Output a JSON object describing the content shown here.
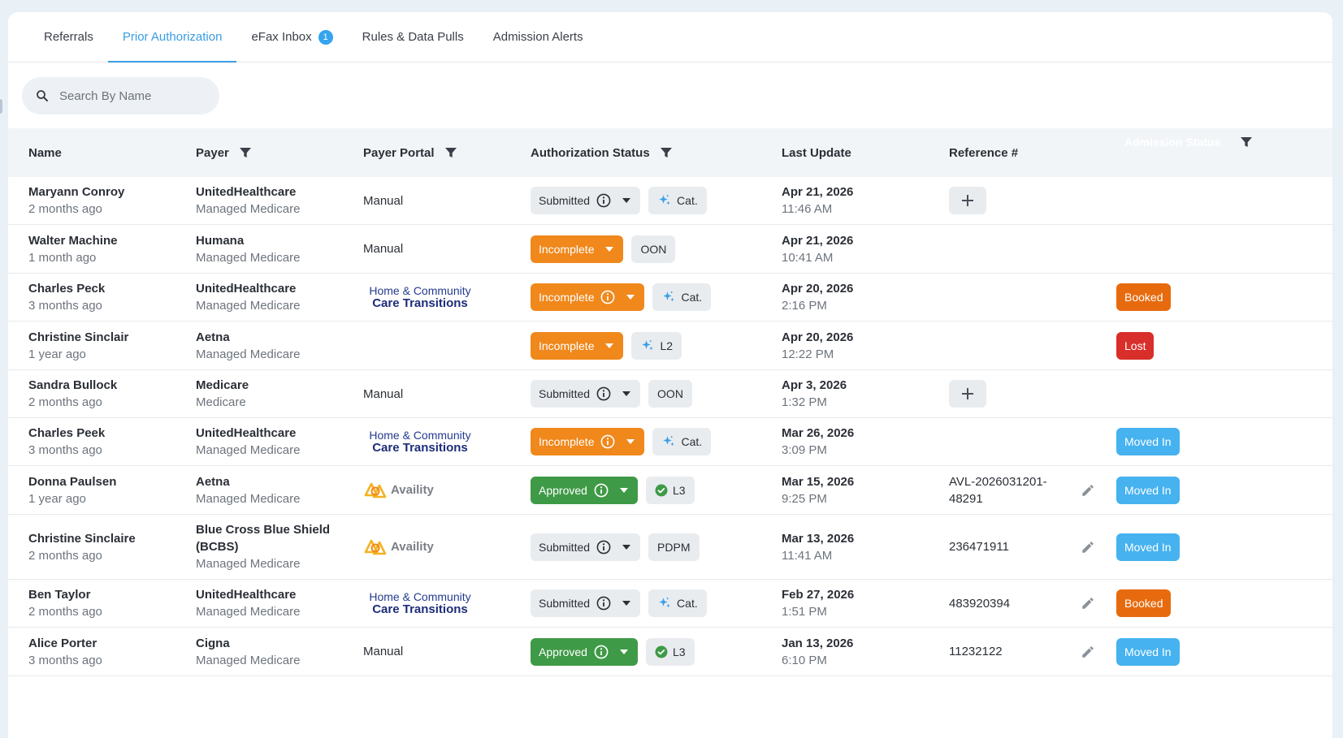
{
  "tabs": [
    {
      "label": "Referrals",
      "active": false
    },
    {
      "label": "Prior Authorization",
      "active": true
    },
    {
      "label": "eFax Inbox",
      "badge": "1",
      "active": false
    },
    {
      "label": "Rules & Data Pulls",
      "active": false
    },
    {
      "label": "Admission Alerts",
      "active": false
    }
  ],
  "search": {
    "placeholder": "Search By Name",
    "value": ""
  },
  "columns": {
    "name": "Name",
    "payer": "Payer",
    "portal": "Payer Portal",
    "auth": "Authorization Status",
    "update": "Last Update",
    "ref": "Reference #",
    "admission": "Admission Status"
  },
  "portal_labels": {
    "manual": "Manual",
    "hcct_line1": "Home & Community",
    "hcct_line2": "Care Transitions",
    "availity": "Availity"
  },
  "rows": [
    {
      "name": "Maryann Conroy",
      "age": "2 months ago",
      "payer": "UnitedHealthcare",
      "plan": "Managed Medicare",
      "portal": "Manual",
      "status": "Submitted",
      "tag": "Cat.",
      "date": "Apr 21, 2026",
      "time": "11:46 AM",
      "ref": "",
      "admission": ""
    },
    {
      "name": "Walter Machine",
      "age": "1 month ago",
      "payer": "Humana",
      "plan": "Managed Medicare",
      "portal": "Manual",
      "status": "Incomplete",
      "tag": "OON",
      "date": "Apr 21, 2026",
      "time": "10:41 AM",
      "ref": "",
      "admission": ""
    },
    {
      "name": "Charles Peck",
      "age": "3 months ago",
      "payer": "UnitedHealthcare",
      "plan": "Managed Medicare",
      "portal": "hcct",
      "status": "Incomplete",
      "tag": "Cat.",
      "date": "Apr 20, 2026",
      "time": "2:16 PM",
      "ref": "",
      "admission": "Booked"
    },
    {
      "name": "Christine Sinclair",
      "age": "1 year ago",
      "payer": "Aetna",
      "plan": "Managed Medicare",
      "portal": "",
      "status": "Incomplete",
      "tag": "L2",
      "date": "Apr 20, 2026",
      "time": "12:22 PM",
      "ref": "",
      "admission": "Lost"
    },
    {
      "name": "Sandra Bullock",
      "age": "2 months ago",
      "payer": "Medicare",
      "plan": "Medicare",
      "portal": "Manual",
      "status": "Submitted",
      "tag": "OON",
      "date": "Apr 3, 2026",
      "time": "1:32 PM",
      "ref": "",
      "admission": ""
    },
    {
      "name": "Charles Peek",
      "age": "3 months ago",
      "payer": "UnitedHealthcare",
      "plan": "Managed Medicare",
      "portal": "hcct",
      "status": "Incomplete",
      "tag": "Cat.",
      "date": "Mar 26, 2026",
      "time": "3:09 PM",
      "ref": "",
      "admission": "Moved In"
    },
    {
      "name": "Donna Paulsen",
      "age": "1 year ago",
      "payer": "Aetna",
      "plan": "Managed Medicare",
      "portal": "availity",
      "status": "Approved",
      "tag": "L3",
      "date": "Mar 15, 2026",
      "time": "9:25 PM",
      "ref": "AVL-2026031201-48291",
      "admission": "Moved In"
    },
    {
      "name": "Christine Sinclaire",
      "age": "2 months ago",
      "payer": "Blue Cross Blue Shield (BCBS)",
      "plan": "Managed Medicare",
      "portal": "availity",
      "status": "Submitted",
      "tag": "PDPM",
      "date": "Mar 13, 2026",
      "time": "11:41 AM",
      "ref": "236471911",
      "admission": "Moved In"
    },
    {
      "name": "Ben Taylor",
      "age": "2 months ago",
      "payer": "UnitedHealthcare",
      "plan": "Managed Medicare",
      "portal": "hcct",
      "status": "Submitted",
      "tag": "Cat.",
      "date": "Feb 27, 2026",
      "time": "1:51 PM",
      "ref": "483920394",
      "admission": "Booked"
    },
    {
      "name": "Alice Porter",
      "age": "3 months ago",
      "payer": "Cigna",
      "plan": "Managed Medicare",
      "portal": "Manual",
      "status": "Approved",
      "tag": "L3",
      "date": "Jan 13, 2026",
      "time": "6:10 PM",
      "ref": "11232122",
      "admission": "Moved In"
    }
  ],
  "colors": {
    "accent": "#3a9ce2",
    "incomplete": "#f0881c",
    "approved": "#3f9a47",
    "booked": "#e76b0e",
    "lost": "#d92f2b",
    "moved_in": "#46b2ef"
  },
  "icons": {
    "search": "search-icon",
    "filter": "filter-icon",
    "info": "info-icon",
    "sparkle": "sparkle-icon",
    "check": "check-circle-icon",
    "plus": "plus-icon",
    "edit": "pencil-icon"
  }
}
